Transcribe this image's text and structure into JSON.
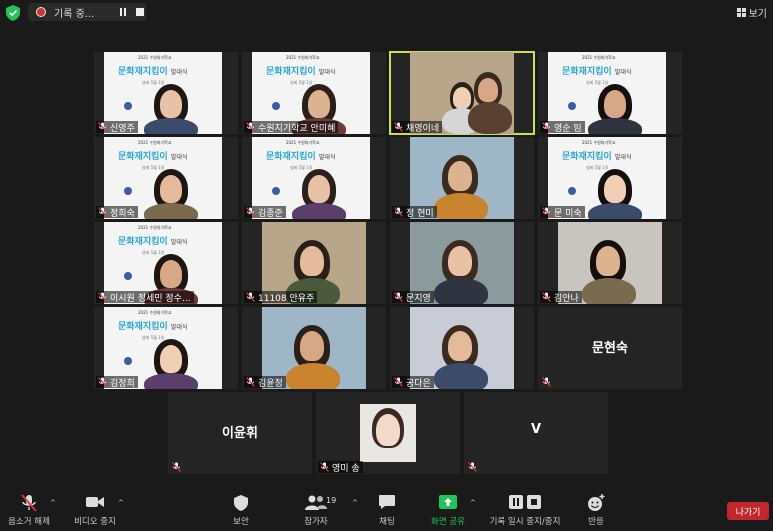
{
  "recording": {
    "label": "기록 중..."
  },
  "view_button": {
    "label": "보기"
  },
  "participants": [
    {
      "name": "신영주",
      "kind": "slide"
    },
    {
      "name": "수원지기학교 안미혜",
      "kind": "slide"
    },
    {
      "name": "채영이네",
      "kind": "video",
      "active": true
    },
    {
      "name": "영순 임",
      "kind": "slide"
    },
    {
      "name": "정희숙",
      "kind": "slide"
    },
    {
      "name": "김종준",
      "kind": "slide"
    },
    {
      "name": "정 현미",
      "kind": "video"
    },
    {
      "name": "문 미숙",
      "kind": "slide"
    },
    {
      "name": "이시원 정세민 정수...",
      "kind": "slide"
    },
    {
      "name": "11108 안유주",
      "kind": "video"
    },
    {
      "name": "문지영",
      "kind": "video"
    },
    {
      "name": "김안나",
      "kind": "video"
    },
    {
      "name": "김정희",
      "kind": "slide"
    },
    {
      "name": "김윤정",
      "kind": "video"
    },
    {
      "name": "공다은",
      "kind": "video"
    },
    {
      "name": "문현숙",
      "kind": "name"
    },
    {
      "name": "이윤휘",
      "kind": "name"
    },
    {
      "name": "영미 송",
      "kind": "photo"
    },
    {
      "name": "V",
      "kind": "name"
    }
  ],
  "slide_text": {
    "line1": "2021 수원외기학교",
    "line2": "문화재지킴이",
    "line2b": "발대식",
    "line3": "날짜 5월 1일"
  },
  "toolbar": {
    "unmute": "음소거 해제",
    "stop_video": "비디오 중지",
    "security": "보안",
    "participants": "참가자",
    "participants_count": "19",
    "chat": "채팅",
    "share": "화면 공유",
    "pause_recording": "기록 일시 중지/중지",
    "reactions": "반응",
    "leave": "나가기"
  },
  "colors": {
    "active_border": "#c8e04a",
    "leave": "#c1272d",
    "share_green": "#22c35a",
    "slide_title": "#27a8d8"
  }
}
